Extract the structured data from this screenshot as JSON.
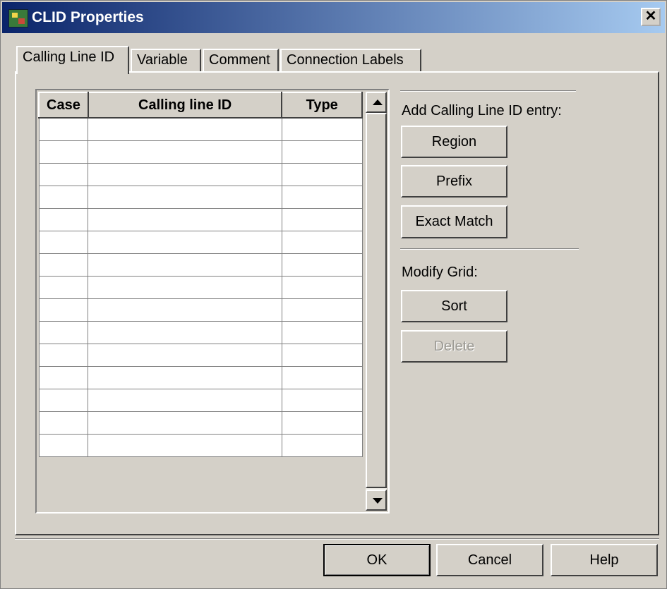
{
  "window": {
    "title": "CLID Properties",
    "close_glyph": "✕"
  },
  "tabs": [
    {
      "label": "Calling Line ID",
      "active": true
    },
    {
      "label": "Variable",
      "active": false
    },
    {
      "label": "Comment",
      "active": false
    },
    {
      "label": "Connection Labels",
      "active": false
    }
  ],
  "grid": {
    "columns": [
      "Case",
      "Calling line ID",
      "Type"
    ],
    "rows": [
      [
        "",
        "",
        ""
      ],
      [
        "",
        "",
        ""
      ],
      [
        "",
        "",
        ""
      ],
      [
        "",
        "",
        ""
      ],
      [
        "",
        "",
        ""
      ],
      [
        "",
        "",
        ""
      ],
      [
        "",
        "",
        ""
      ],
      [
        "",
        "",
        ""
      ],
      [
        "",
        "",
        ""
      ],
      [
        "",
        "",
        ""
      ],
      [
        "",
        "",
        ""
      ],
      [
        "",
        "",
        ""
      ],
      [
        "",
        "",
        ""
      ],
      [
        "",
        "",
        ""
      ],
      [
        "",
        "",
        ""
      ]
    ]
  },
  "add_section": {
    "label": "Add Calling Line ID entry:",
    "region": "Region",
    "prefix": "Prefix",
    "exact_match": "Exact Match"
  },
  "modify_section": {
    "label": "Modify Grid:",
    "sort": "Sort",
    "delete": "Delete"
  },
  "footer": {
    "ok": "OK",
    "cancel": "Cancel",
    "help": "Help"
  },
  "colors": {
    "face": "#d4d0c8",
    "title_start": "#0a246a",
    "title_end": "#a6caf0"
  }
}
